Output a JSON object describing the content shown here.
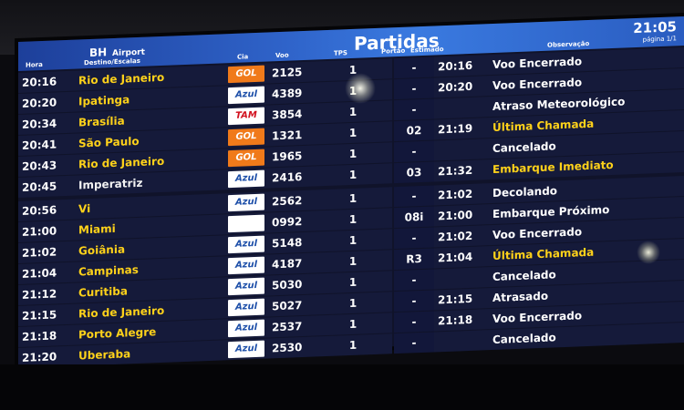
{
  "board": {
    "logo_main": "BH",
    "logo_sub": "Airport",
    "title": "Partidas",
    "clock": "21:05",
    "page_label": "página 1/1"
  },
  "columns": {
    "hora": "Hora",
    "destino": "Destino/Escalas",
    "cia": "Cia",
    "voo": "Voo",
    "tps": "TPS",
    "portao": "Portão",
    "estimado": "Estimado",
    "observacao": "Observação"
  },
  "flights": [
    {
      "hora": "20:16",
      "destino": "Rio de Janeiro",
      "cia": "GOL",
      "voo": "2125",
      "tps": "1",
      "portao": "-",
      "estimado": "20:16",
      "obs": "Voo Encerrado"
    },
    {
      "hora": "20:20",
      "destino": "Ipatinga",
      "cia": "Azul",
      "voo": "4389",
      "tps": "1",
      "portao": "-",
      "estimado": "20:20",
      "obs": "Voo Encerrado"
    },
    {
      "hora": "20:34",
      "destino": "Brasília",
      "cia": "TAM",
      "voo": "3854",
      "tps": "1",
      "portao": "-",
      "estimado": "",
      "obs": "Atraso Meteorológico"
    },
    {
      "hora": "20:41",
      "destino": "São Paulo",
      "cia": "GOL",
      "voo": "1321",
      "tps": "1",
      "portao": "02",
      "estimado": "21:19",
      "obs": "Última Chamada"
    },
    {
      "hora": "20:43",
      "destino": "Rio de Janeiro",
      "cia": "GOL",
      "voo": "1965",
      "tps": "1",
      "portao": "-",
      "estimado": "",
      "obs": "Cancelado"
    },
    {
      "hora": "20:45",
      "destino": "Imperatriz",
      "cia": "Azul",
      "voo": "2416",
      "tps": "1",
      "portao": "03",
      "estimado": "21:32",
      "obs": "Embarque Imediato"
    },
    {
      "hora": "20:56",
      "destino": "Vi",
      "cia": "Azul",
      "voo": "2562",
      "tps": "1",
      "portao": "-",
      "estimado": "21:02",
      "obs": "Decolando"
    },
    {
      "hora": "21:00",
      "destino": "Miami",
      "cia": "",
      "voo": "0992",
      "tps": "1",
      "portao": "08i",
      "estimado": "21:00",
      "obs": "Embarque Próximo"
    },
    {
      "hora": "21:02",
      "destino": "Goiânia",
      "cia": "Azul",
      "voo": "5148",
      "tps": "1",
      "portao": "-",
      "estimado": "21:02",
      "obs": "Voo Encerrado"
    },
    {
      "hora": "21:04",
      "destino": "Campinas",
      "cia": "Azul",
      "voo": "4187",
      "tps": "1",
      "portao": "R3",
      "estimado": "21:04",
      "obs": "Última Chamada"
    },
    {
      "hora": "21:12",
      "destino": "Curitiba",
      "cia": "Azul",
      "voo": "5030",
      "tps": "1",
      "portao": "-",
      "estimado": "",
      "obs": "Cancelado"
    },
    {
      "hora": "21:15",
      "destino": "Rio de Janeiro",
      "cia": "Azul",
      "voo": "5027",
      "tps": "1",
      "portao": "-",
      "estimado": "21:15",
      "obs": "Atrasado"
    },
    {
      "hora": "21:18",
      "destino": "Porto Alegre",
      "cia": "Azul",
      "voo": "2537",
      "tps": "1",
      "portao": "-",
      "estimado": "21:18",
      "obs": "Voo Encerrado"
    },
    {
      "hora": "21:20",
      "destino": "Uberaba",
      "cia": "Azul",
      "voo": "2530",
      "tps": "1",
      "portao": "-",
      "estimado": "",
      "obs": "Cancelado"
    }
  ],
  "colors": {
    "header_blue": "#2f63c9",
    "row_bg": "#151a3a",
    "destination_yellow": "#ffd21a",
    "gol_orange": "#f07a1a",
    "azul_blue": "#1c4ea8",
    "tam_red": "#d2121f"
  }
}
